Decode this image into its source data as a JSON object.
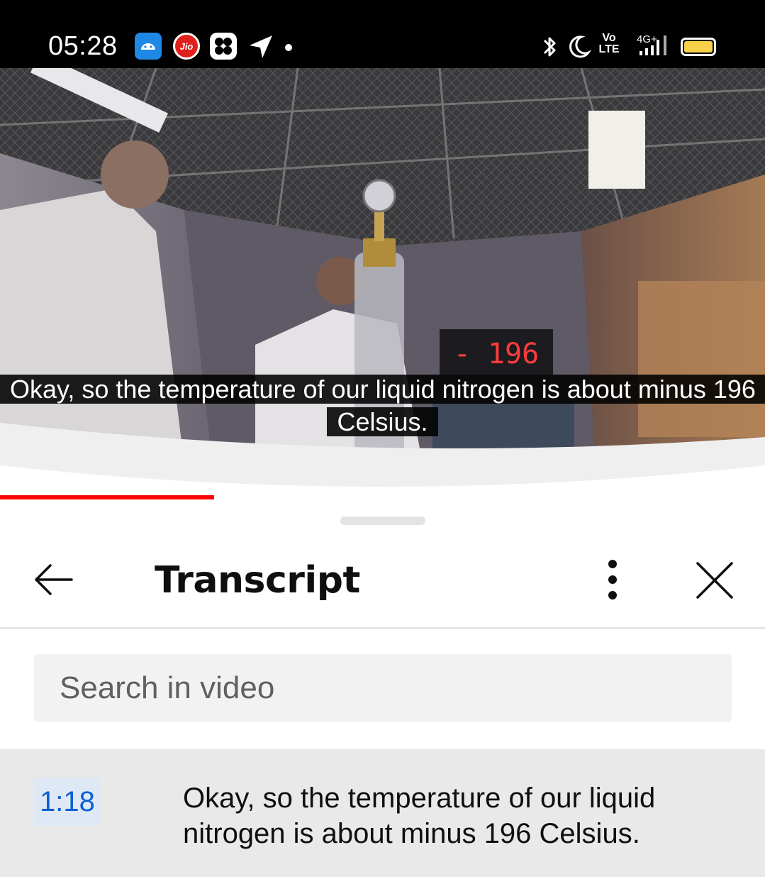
{
  "status_bar": {
    "time": "05:28",
    "carrier_badge": "Jio",
    "volte_line1": "Vo",
    "volte_line2": "LTE",
    "network": "4G+",
    "icons": [
      "android-app-icon",
      "jio-icon",
      "fan-app-icon",
      "navigation-icon",
      "notification-dot-icon",
      "bluetooth-icon",
      "moon-icon",
      "volte-icon",
      "signal-icon",
      "battery-icon"
    ],
    "battery_color": "#f6d24a"
  },
  "video": {
    "display_reading": "- 196",
    "caption": "Okay, so the temperature of our liquid nitrogen is about minus 196 Celsius.",
    "progress_fraction": 0.28,
    "progress_color": "#ff0000"
  },
  "panel": {
    "title": "Transcript",
    "search_placeholder": "Search in video",
    "segments": [
      {
        "timestamp": "1:18",
        "text": "Okay, so the temperature of our liquid nitrogen is about minus 196 Celsius."
      }
    ],
    "timestamp_color": "#065fd4",
    "icons": [
      "back-arrow-icon",
      "more-vert-icon",
      "close-icon"
    ]
  }
}
